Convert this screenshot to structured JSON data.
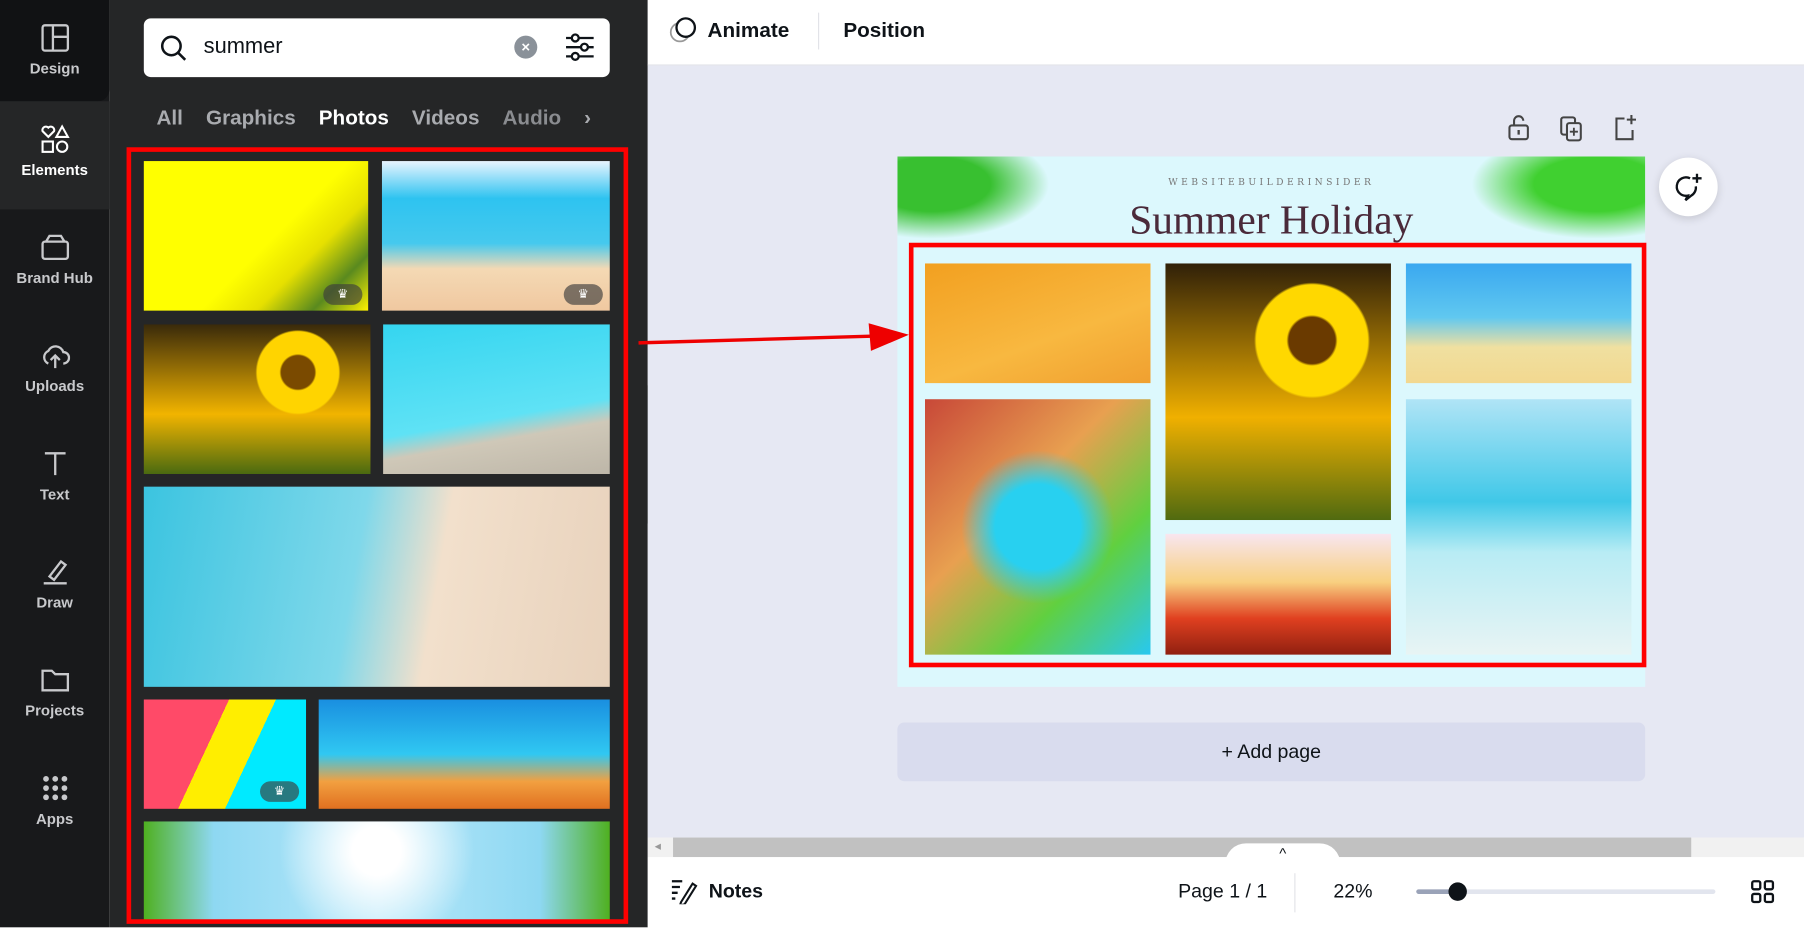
{
  "sidebar": {
    "items": [
      {
        "label": "Design",
        "icon": "layout-icon"
      },
      {
        "label": "Elements",
        "icon": "shapes-icon",
        "selected": true
      },
      {
        "label": "Brand Hub",
        "icon": "brand-icon"
      },
      {
        "label": "Uploads",
        "icon": "cloud-upload-icon"
      },
      {
        "label": "Text",
        "icon": "text-icon"
      },
      {
        "label": "Draw",
        "icon": "pen-icon"
      },
      {
        "label": "Projects",
        "icon": "folder-icon"
      },
      {
        "label": "Apps",
        "icon": "grid-icon"
      }
    ]
  },
  "search": {
    "value": "summer",
    "placeholder": ""
  },
  "tabs": [
    {
      "label": "All"
    },
    {
      "label": "Graphics"
    },
    {
      "label": "Photos",
      "active": true
    },
    {
      "label": "Videos"
    },
    {
      "label": "Audio"
    }
  ],
  "toolbar": {
    "animate": "Animate",
    "position": "Position"
  },
  "design": {
    "brand": "WEBSITEBUILDERINSIDER",
    "title": "Summer Holiday"
  },
  "add_page": "+ Add page",
  "footer": {
    "notes": "Notes",
    "page": "Page 1 / 1",
    "zoom": "22%",
    "zoom_value": 22
  },
  "colors": {
    "highlight": "#ff0000",
    "rail": "#18191b",
    "panel": "#252627",
    "canvas": "#e6e8f3",
    "title": "#4a2a3a"
  }
}
